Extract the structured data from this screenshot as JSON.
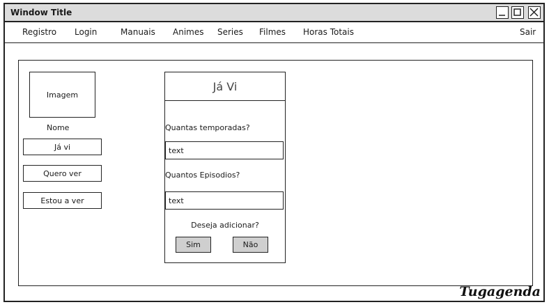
{
  "window": {
    "title": "Window Title",
    "controls": [
      "minimize-icon",
      "maximize-icon",
      "close-icon"
    ]
  },
  "menu": {
    "items": [
      {
        "label": "Registro"
      },
      {
        "label": "Login"
      },
      {
        "label": "Manuais"
      },
      {
        "label": "Animes"
      },
      {
        "label": "Series"
      },
      {
        "label": "Filmes"
      },
      {
        "label": "Horas Totais"
      }
    ],
    "logout": "Sair"
  },
  "media": {
    "image_placeholder": "Imagem",
    "name_label": "Nome",
    "buttons": [
      "Já vi",
      "Quero ver",
      "Estou a ver"
    ]
  },
  "dialog": {
    "title": "Já Vi",
    "seasons_question": "Quantas temporadas?",
    "seasons_value": "text",
    "episodes_question": "Quantos Episodios?",
    "episodes_value": "text",
    "confirm_question": "Deseja adicionar?",
    "yes_label": "Sim",
    "no_label": "Não"
  },
  "brand": "Tugagenda"
}
